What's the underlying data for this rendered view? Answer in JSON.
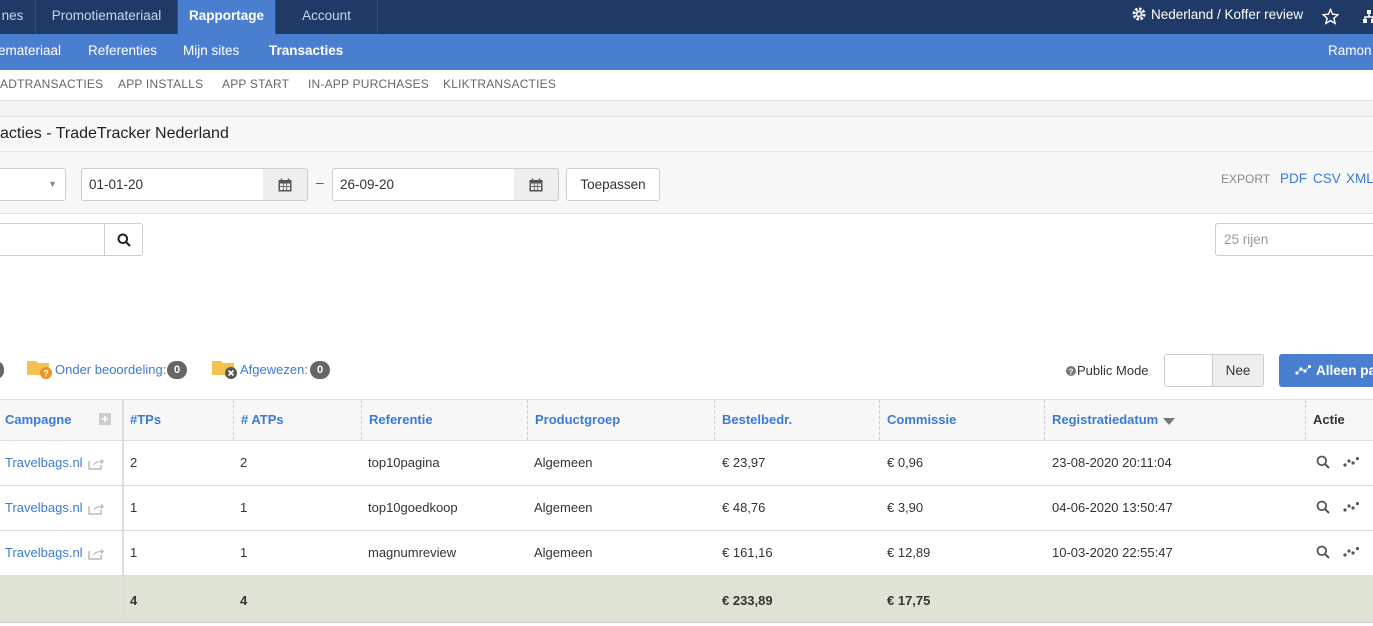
{
  "topnav": {
    "tabs": [
      "nes",
      "Promotiemateriaal",
      "Rapportage",
      "Account"
    ],
    "active": "Rapportage",
    "site_selector": "Nederland / Koffer review"
  },
  "subnav": {
    "items": [
      "emateriaal",
      "Referenties",
      "Mijn sites",
      "Transacties"
    ],
    "active": "Transacties",
    "user": "Ramon"
  },
  "thirdnav": {
    "items": [
      "ADTRANSACTIES",
      "APP INSTALLS",
      "APP START",
      "IN-APP PURCHASES",
      "KLIKTRANSACTIES"
    ]
  },
  "page_title": "acties - TradeTracker Nederland",
  "filters": {
    "date_from": "01-01-20",
    "date_sep": "–",
    "date_to": "26-09-20",
    "apply_label": "Toepassen",
    "export_label": "EXPORT",
    "export_links": [
      "PDF",
      "CSV",
      "XML"
    ]
  },
  "search": {
    "rows_placeholder": "25 rijen"
  },
  "status": {
    "under_review_label": "Onder beoordeling:",
    "under_review_count": "0",
    "rejected_label": "Afgewezen:",
    "rejected_count": "0",
    "public_mode_label": "Public Mode",
    "public_mode_value": "Nee",
    "only_button": "Alleen pa"
  },
  "table": {
    "headers": [
      "Campagne",
      "#TPs",
      "# ATPs",
      "Referentie",
      "Productgroep",
      "Bestelbedr.",
      "Commissie",
      "Registratiedatum",
      "Actie"
    ],
    "rows": [
      {
        "campagne": "Travelbags.nl",
        "tps": "2",
        "atps": "2",
        "referentie": "top10pagina",
        "productgroep": "Algemeen",
        "bestel": "€ 23,97",
        "commissie": "€ 0,96",
        "datum": "23-08-2020 20:11:04"
      },
      {
        "campagne": "Travelbags.nl",
        "tps": "1",
        "atps": "1",
        "referentie": "top10goedkoop",
        "productgroep": "Algemeen",
        "bestel": "€ 48,76",
        "commissie": "€ 3,90",
        "datum": "04-06-2020 13:50:47"
      },
      {
        "campagne": "Travelbags.nl",
        "tps": "1",
        "atps": "1",
        "referentie": "magnumreview",
        "productgroep": "Algemeen",
        "bestel": "€ 161,16",
        "commissie": "€ 12,89",
        "datum": "10-03-2020 22:55:47"
      }
    ],
    "totals": {
      "tps": "4",
      "atps": "4",
      "bestel": "€ 233,89",
      "commissie": "€ 17,75"
    }
  },
  "colors": {
    "navy": "#1f3a66",
    "blue": "#4a7fd0",
    "link": "#3a7bd5",
    "total_bg": "#dfe3d3",
    "folder": "#f2c14e"
  }
}
